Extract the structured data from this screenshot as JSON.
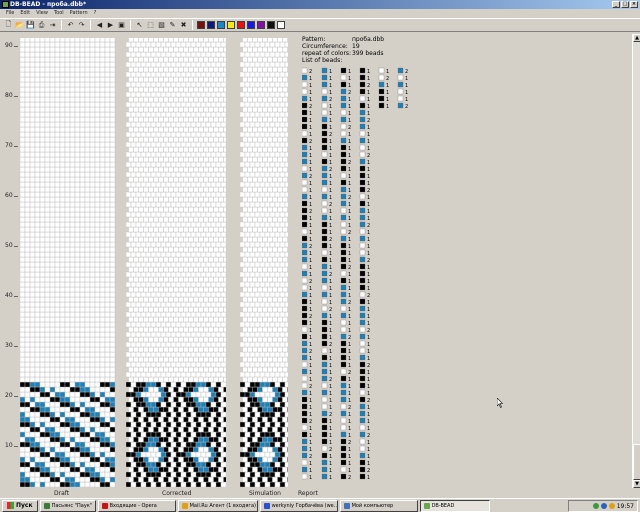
{
  "window": {
    "title": "DB-BEAD - проба.dbb*"
  },
  "menu": [
    "File",
    "Edit",
    "View",
    "Tool",
    "Pattern",
    "?"
  ],
  "toolbar": {
    "buttons": [
      "new-icon",
      "open-icon",
      "save-icon",
      "print-icon",
      "export-icon",
      "undo-icon",
      "redo-icon",
      "prev-icon",
      "next-icon",
      "preview-icon",
      "pointer-icon",
      "select-icon",
      "fill-icon",
      "pipette-icon",
      "clear-icon"
    ],
    "colors": [
      "#7a1010",
      "#101a7a",
      "#1a88c8",
      "#f4ec10",
      "#e81010",
      "#1818e8",
      "#8010a8",
      "#101010",
      "#ffffff"
    ]
  },
  "ruler": {
    "labels": [
      "90",
      "80",
      "70",
      "60",
      "50",
      "40",
      "30",
      "20",
      "10"
    ]
  },
  "panels": {
    "draft": "Draft",
    "corrected": "Corrected",
    "simulation": "Simulation",
    "report": "Report"
  },
  "report": {
    "pattern_label": "Pattern:",
    "pattern_value": "проба.dbb",
    "circ_label": "Circumference:",
    "circ_value": "19",
    "repeat_label": "repeat of colors:",
    "repeat_value": "399 beads",
    "list_label": "List of beads:"
  },
  "palette": {
    "white": "#ffffff",
    "black": "#000000",
    "blue": "#1e80b8",
    "grid": "#b8b8b8"
  },
  "taskbar": {
    "start": "Пуск",
    "items": [
      {
        "label": "Пасьянс \"Паук\"",
        "color": "#3a7a3a"
      },
      {
        "label": "Входящие - Opera",
        "color": "#d01010"
      },
      {
        "label": "Mail.Ru Агент (1 входяга)",
        "color": "#e0a010"
      },
      {
        "label": "werkyniy Горбачёва (wе…",
        "color": "#2a50d0"
      },
      {
        "label": "Мой компьютер",
        "color": "#4070c0"
      },
      {
        "label": "DB-BEAD",
        "color": "#6aa84f",
        "active": true
      }
    ],
    "clock": "19:57"
  }
}
